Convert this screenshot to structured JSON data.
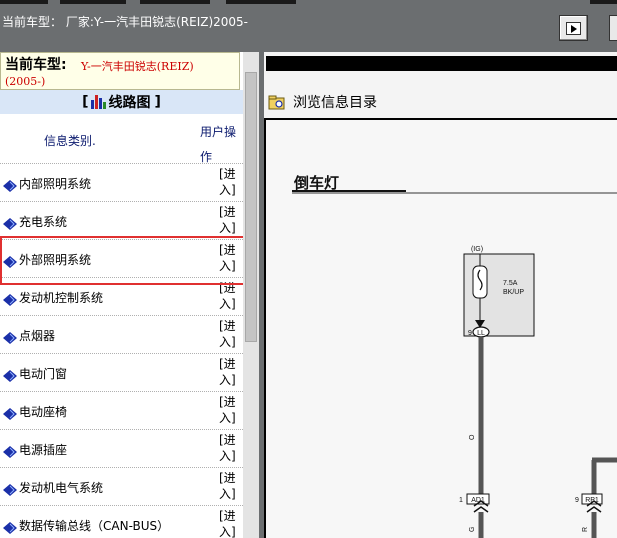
{
  "window": {
    "title": "当前车型：  厂家:Y-一汽丰田锐志(REIZ)2005-"
  },
  "model": {
    "label": "当前车型:",
    "value_line1": "Y-一汽丰田锐志(REIZ)",
    "value_line2": "(2005-)"
  },
  "section": {
    "bracket_open": "[",
    "title": "线路图",
    "bracket_close": "]"
  },
  "table": {
    "col_type": "信息类别.",
    "col_op_line1": "用户操",
    "col_op_line2": "作",
    "enter_line1": "[进",
    "enter_line2": "入]",
    "rows": [
      "内部照明系统",
      "充电系统",
      "外部照明系统",
      "发动机控制系统",
      "点烟器",
      "电动门窗",
      "电动座椅",
      "电源插座",
      "发动机电气系统",
      "数据传输总线（CAN-BUS）"
    ]
  },
  "right": {
    "browse_label": "浏览信息目录",
    "doc_title": "倒车灯",
    "fuse_top": "(IG)",
    "fuse_rating": "7.5A",
    "fuse_name": "BK/UP",
    "pin_ll_num": "9",
    "pin_ll": "LL",
    "wire_o": "O",
    "ad1_num": "1",
    "ad1": "AD1",
    "rp1_num": "9",
    "rp1": "RP1",
    "wire_r": "R",
    "wire_g": "G"
  },
  "colors": {
    "topbar": "#6b6e70",
    "section_bar": "#d9e6f7",
    "header_text": "#0b1a6e",
    "model_value": "#cc0000",
    "highlight": "#e03030",
    "row_icon": "#1a2fa8"
  }
}
